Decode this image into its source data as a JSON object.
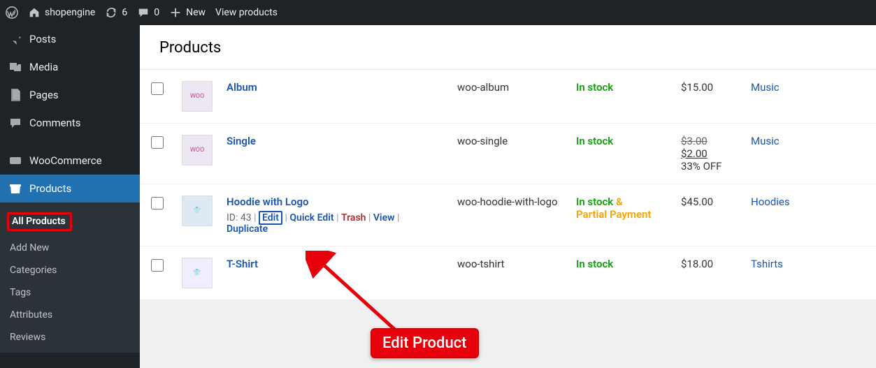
{
  "adminbar": {
    "site": "shopengine",
    "updates": "6",
    "comments": "0",
    "new": "New",
    "view": "View products"
  },
  "sidebar": {
    "posts": "Posts",
    "media": "Media",
    "pages": "Pages",
    "comments": "Comments",
    "woocommerce": "WooCommerce",
    "products": "Products",
    "sub": {
      "all": "All Products",
      "add": "Add New",
      "categories": "Categories",
      "tags": "Tags",
      "attributes": "Attributes",
      "reviews": "Reviews"
    }
  },
  "page_title": "Products",
  "rows": [
    {
      "name": "Album",
      "sku": "woo-album",
      "stock": "In stock",
      "price": "$15.00",
      "category": "Music"
    },
    {
      "name": "Single",
      "sku": "woo-single",
      "stock": "In stock",
      "price_strike": "$3.00",
      "price_sale": "$2.00",
      "price_note": "33% OFF",
      "category": "Music"
    },
    {
      "name": "Hoodie with Logo",
      "id_label": "ID: 43",
      "actions": {
        "edit": "Edit",
        "quick": "Quick Edit",
        "trash": "Trash",
        "view": "View",
        "dup": "Duplicate"
      },
      "sku": "woo-hoodie-with-logo",
      "stock": "In stock",
      "stock_amp": " & ",
      "partial": "Partial Payment",
      "price": "$45.00",
      "category": "Hoodies"
    },
    {
      "name": "T-Shirt",
      "sku": "woo-tshirt",
      "stock": "In stock",
      "price": "$18.00",
      "category": "Tshirts"
    }
  ],
  "annotation": "Edit Product"
}
